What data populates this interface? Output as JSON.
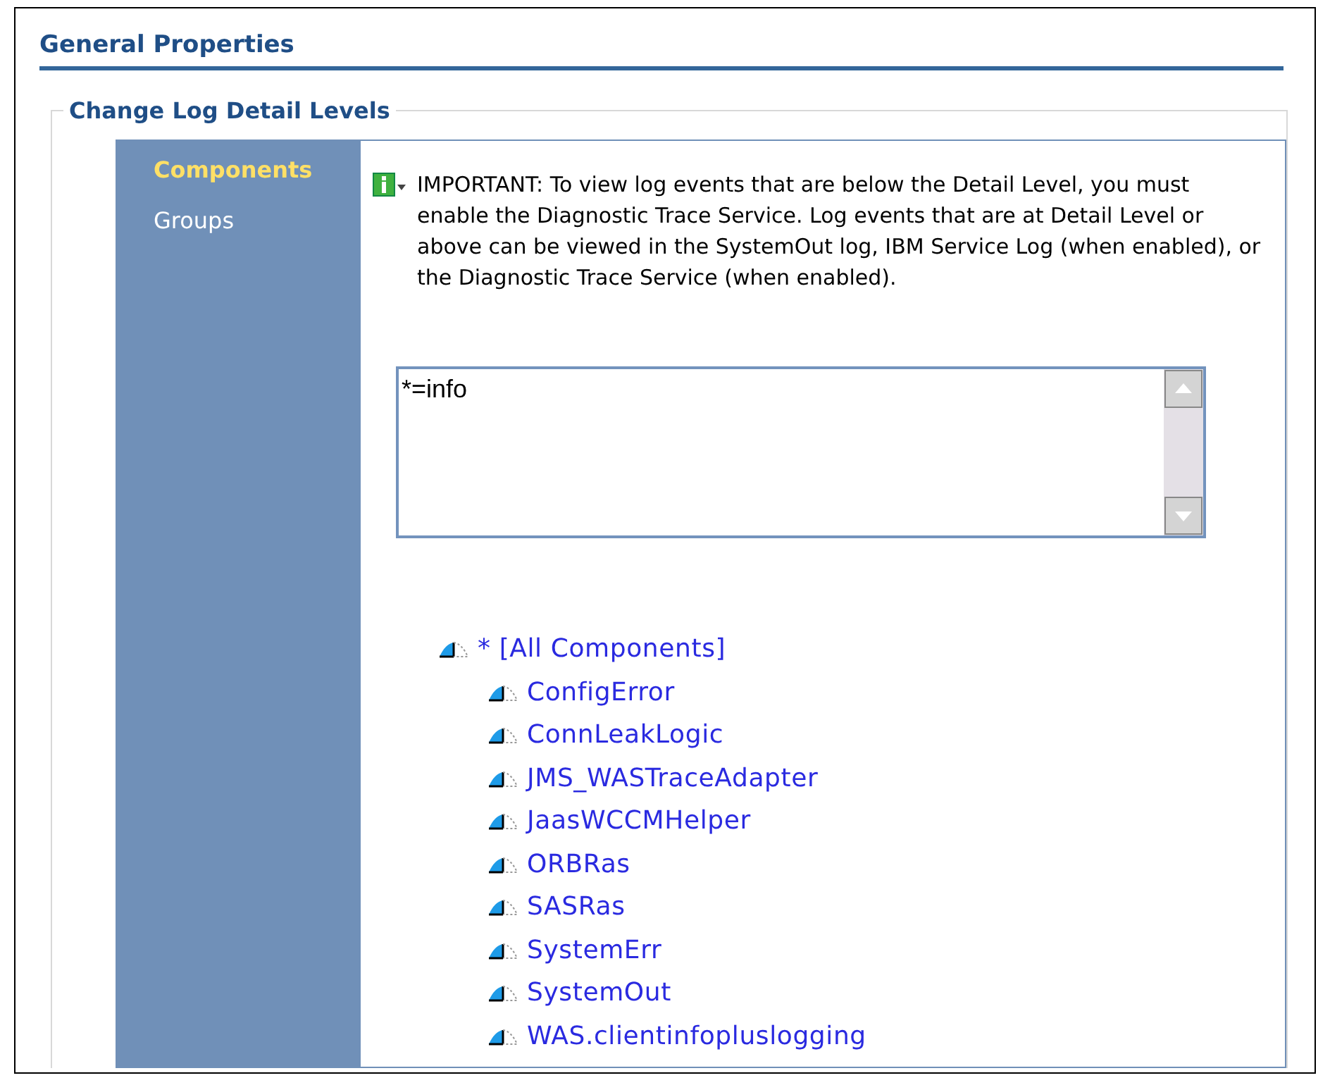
{
  "heading": "General Properties",
  "fieldset": {
    "legend": "Change Log Detail Levels"
  },
  "nav": [
    {
      "label": "Components",
      "selected": true
    },
    {
      "label": "Groups",
      "selected": false
    }
  ],
  "notice": "IMPORTANT: To view log events that are below the Detail Level, you must enable the Diagnostic Trace Service. Log events that are at Detail Level or above can be viewed in the SystemOut log, IBM Service Log (when enabled), or the Diagnostic Trace Service (when enabled).",
  "spec_field": {
    "value": "*=info"
  },
  "tree": [
    {
      "label": "* [All Components]",
      "children": [
        {
          "label": "ConfigError"
        },
        {
          "label": "ConnLeakLogic"
        },
        {
          "label": "JMS_WASTraceAdapter"
        },
        {
          "label": "JaasWCCMHelper"
        },
        {
          "label": "ORBRas"
        },
        {
          "label": "SASRas"
        },
        {
          "label": "SystemErr"
        },
        {
          "label": "SystemOut"
        },
        {
          "label": "WAS.clientinfopluslogging"
        }
      ]
    }
  ]
}
